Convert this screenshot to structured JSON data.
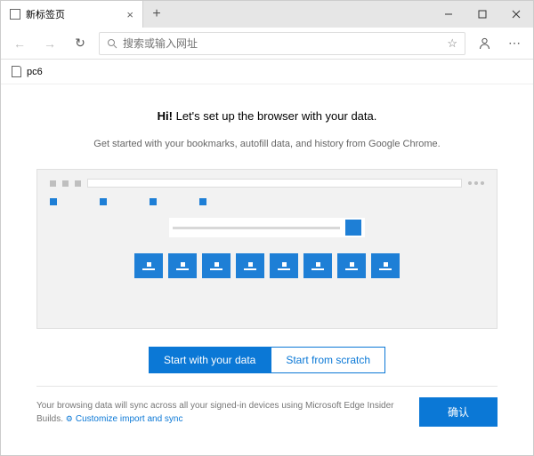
{
  "titlebar": {
    "tab_title": "新标签页"
  },
  "toolbar": {
    "search_placeholder": "搜索或输入网址"
  },
  "favorites": {
    "item1": "pc6"
  },
  "setup": {
    "hi": "Hi!",
    "headline": "Let's set up the browser with your data.",
    "sub": "Get started with your bookmarks, autofill data, and history from Google Chrome.",
    "start_data": "Start with your data",
    "start_scratch": "Start from scratch",
    "sync_text": "Your browsing data will sync across all your signed-in devices using Microsoft Edge Insider Builds.",
    "customize": "Customize import and sync",
    "confirm": "确认"
  }
}
